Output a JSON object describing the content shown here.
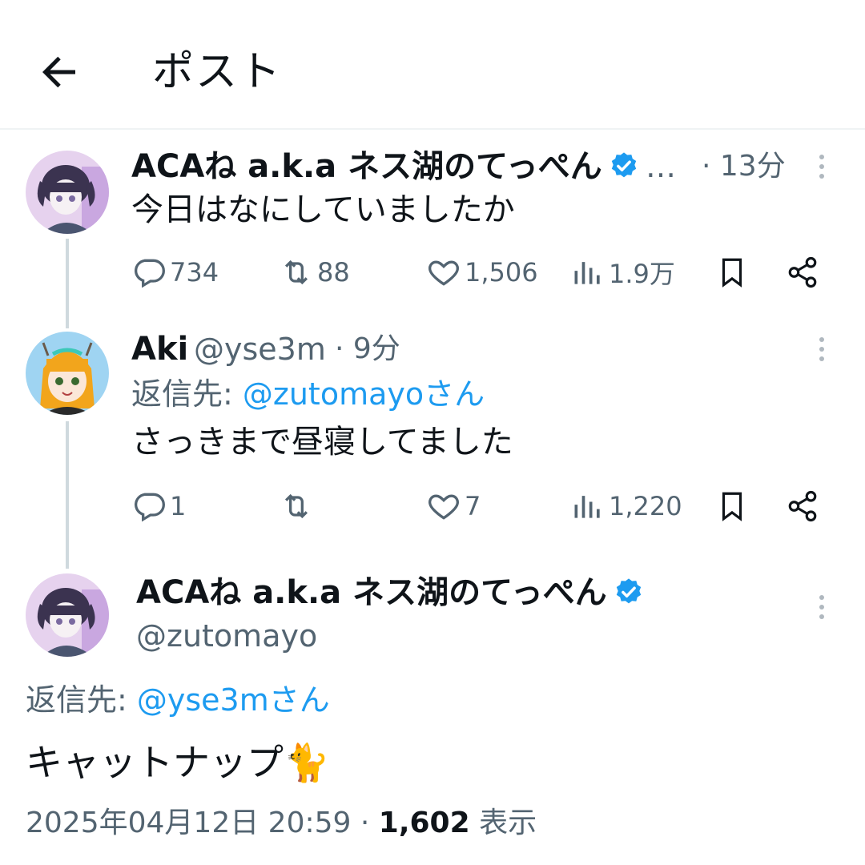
{
  "header": {
    "title": "ポスト"
  },
  "post1": {
    "name": "ACAね a.k.a ネス湖のてっぺん",
    "ellipsis": "…",
    "time": "· 13分",
    "text": "今日はなにしていましたか",
    "replies": "734",
    "retweets": "88",
    "likes": "1,506",
    "views": "1.9万"
  },
  "post2": {
    "name": "Aki",
    "handle": "@yse3m",
    "time": "· 9分",
    "reply_prefix": "返信先: ",
    "reply_target": "@zutomayoさん",
    "text": "さっきまで昼寝してました",
    "replies": "1",
    "retweets": "",
    "likes": "7",
    "views": "1,220"
  },
  "main": {
    "name": "ACAね a.k.a ネス湖のてっぺん",
    "handle": "@zutomayo",
    "reply_prefix": "返信先: ",
    "reply_target": "@yse3mさん",
    "text": "キャットナップ",
    "emoji": "🐈",
    "timestamp": "2025年04月12日 20:59 · ",
    "views_count": "1,602",
    "views_label": "表示"
  },
  "colors": {
    "accent": "#1d9bf0",
    "muted": "#536471",
    "verified": "#1d9bf0"
  }
}
